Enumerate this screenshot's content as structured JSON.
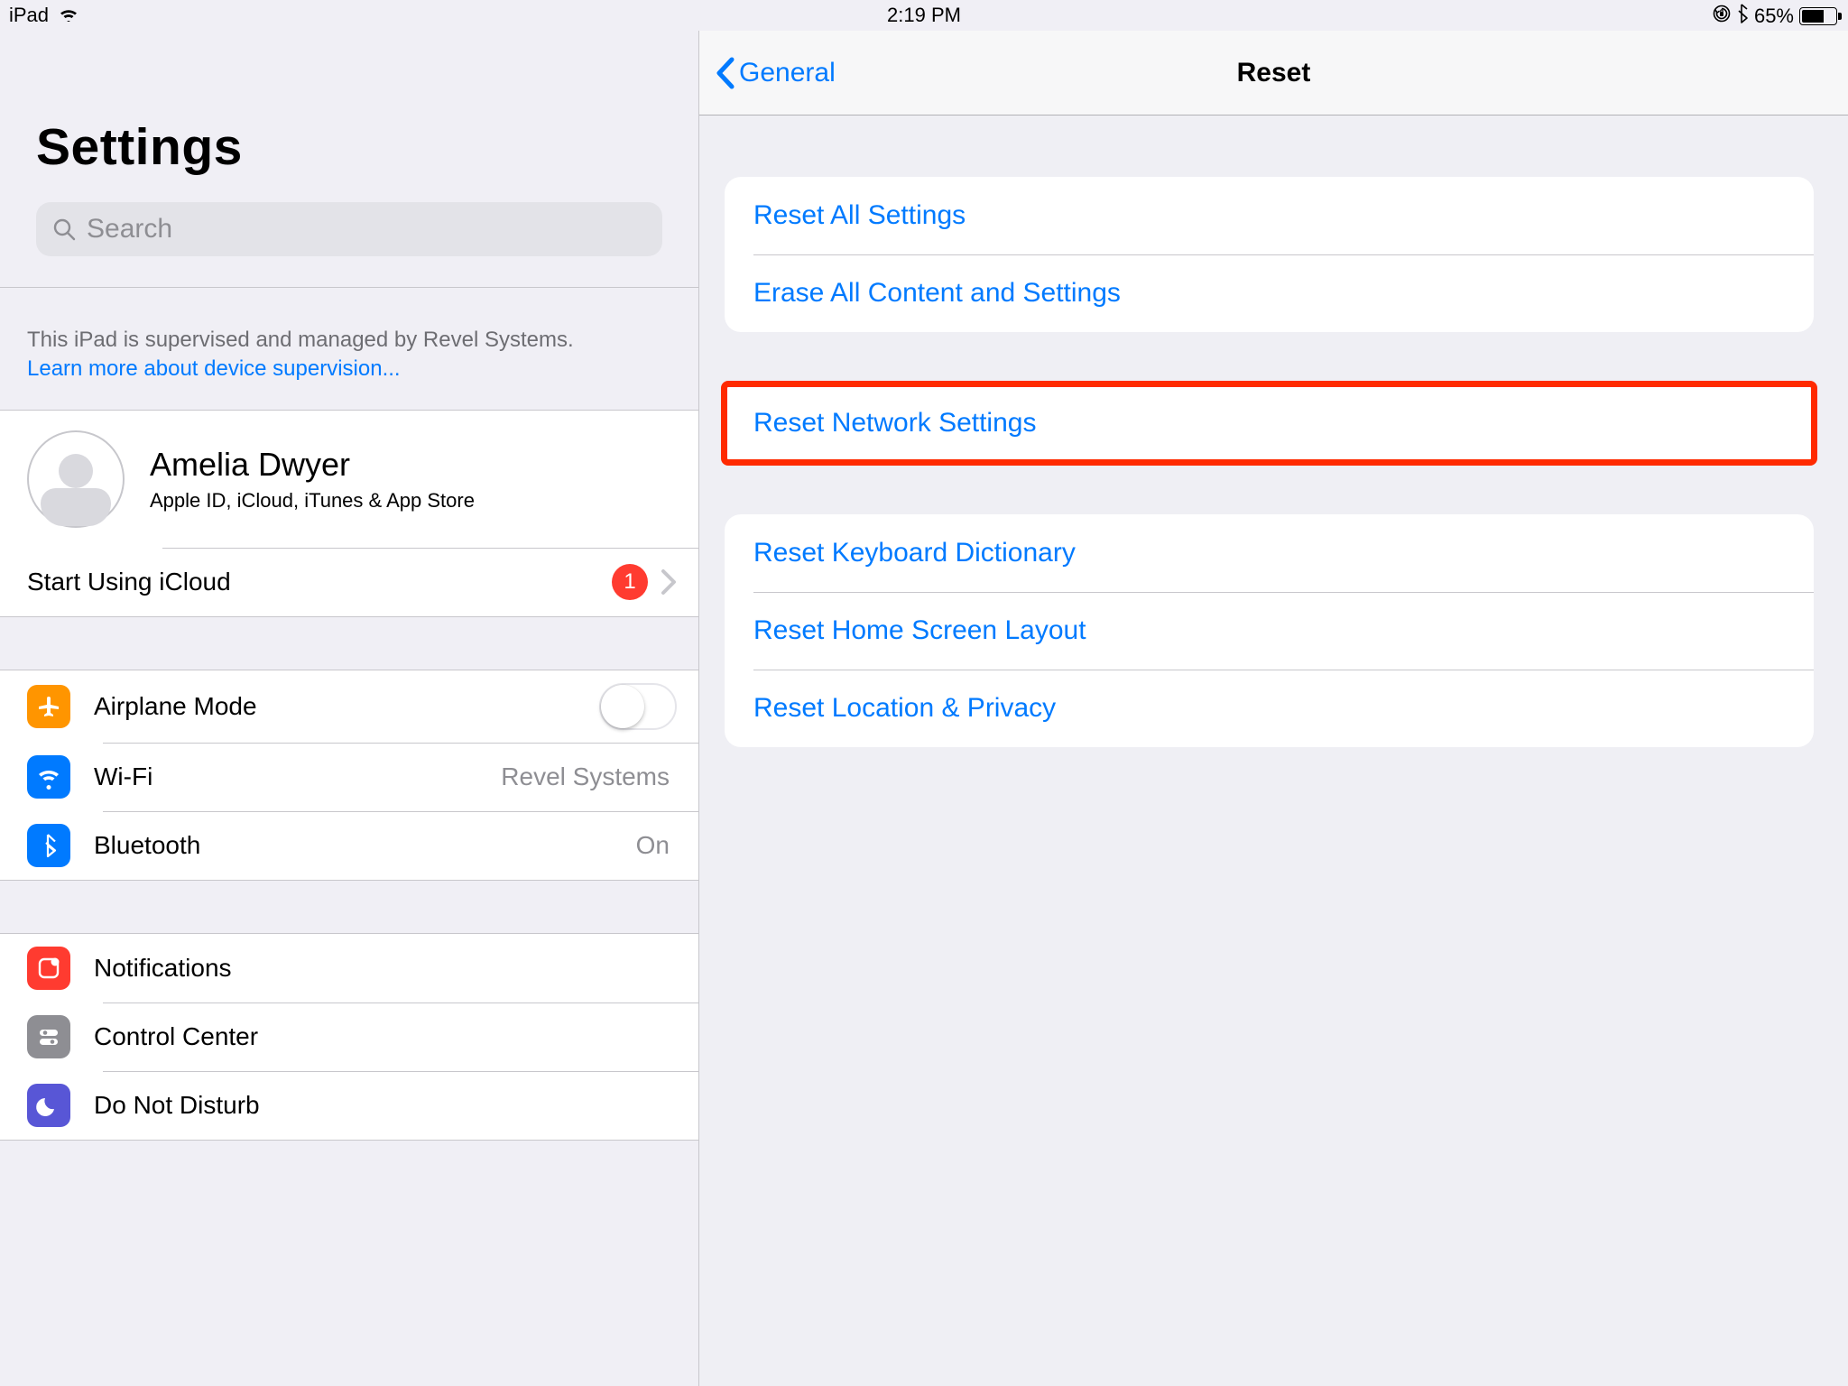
{
  "status": {
    "device": "iPad",
    "time": "2:19 PM",
    "battery_pct": "65%"
  },
  "sidebar": {
    "title": "Settings",
    "search_placeholder": "Search",
    "mdm_text": "This iPad is supervised and managed by Revel Systems.",
    "mdm_link": "Learn more about device supervision...",
    "profile": {
      "name": "Amelia Dwyer",
      "sub": "Apple ID, iCloud, iTunes & App Store",
      "icloud_label": "Start Using iCloud",
      "icloud_badge": "1"
    },
    "g1": {
      "airplane": "Airplane Mode",
      "wifi": "Wi-Fi",
      "wifi_val": "Revel Systems",
      "bt": "Bluetooth",
      "bt_val": "On"
    },
    "g2": {
      "notif": "Notifications",
      "cc": "Control Center",
      "dnd": "Do Not Disturb"
    }
  },
  "detail": {
    "back": "General",
    "title": "Reset",
    "s1": {
      "a": "Reset All Settings",
      "b": "Erase All Content and Settings"
    },
    "s2": {
      "a": "Reset Network Settings"
    },
    "s3": {
      "a": "Reset Keyboard Dictionary",
      "b": "Reset Home Screen Layout",
      "c": "Reset Location & Privacy"
    }
  }
}
